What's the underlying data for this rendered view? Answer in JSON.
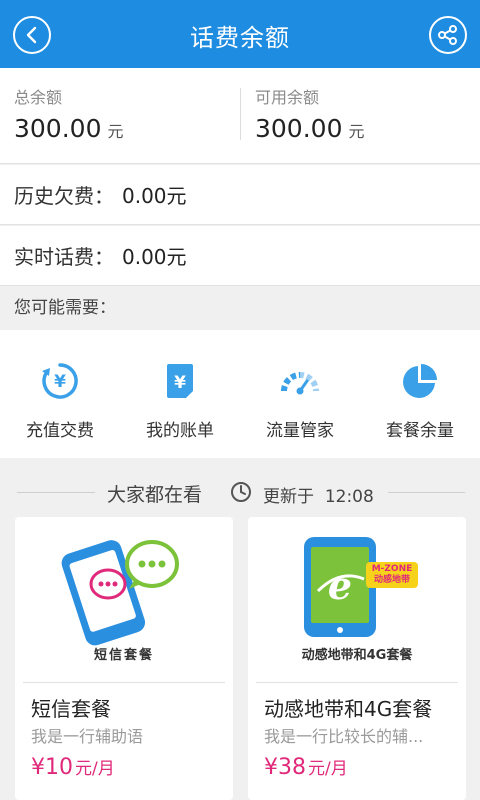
{
  "header": {
    "title": "话费余额",
    "back_icon": "back-arrow-icon",
    "share_icon": "share-icon",
    "bg_color": "#1e8ce0"
  },
  "balance": {
    "total": {
      "label": "总余额",
      "amount": "300.00",
      "unit": "元"
    },
    "available": {
      "label": "可用余额",
      "amount": "300.00",
      "unit": "元"
    }
  },
  "rows": [
    {
      "label": "历史欠费：",
      "value": "0.00元"
    },
    {
      "label": "实时话费：",
      "value": "0.00元"
    }
  ],
  "need_title": "您可能需要：",
  "quick": [
    {
      "label": "充值交费",
      "icon": "recharge-icon"
    },
    {
      "label": "我的账单",
      "icon": "bill-icon"
    },
    {
      "label": "流量管家",
      "icon": "data-gauge-icon"
    },
    {
      "label": "套餐余量",
      "icon": "pie-chart-icon"
    }
  ],
  "section": {
    "title": "大家都在看",
    "update_label": "更新于",
    "update_time": "12:08"
  },
  "cards": [
    {
      "image_caption": "短信套餐",
      "title": "短信套餐",
      "subtitle": "我是一行辅助语",
      "price": "¥10",
      "unit": "元/月"
    },
    {
      "image_caption": "动感地带和4G套餐",
      "title": "动感地带和4G套餐",
      "subtitle": "我是一行比较长的辅...",
      "price": "¥38",
      "unit": "元/月",
      "logo_text": "M-ZONE 动感地带"
    }
  ],
  "colors": {
    "accent": "#1e8ce0",
    "icon_blue": "#3aa0e8",
    "price": "#e0297a"
  }
}
